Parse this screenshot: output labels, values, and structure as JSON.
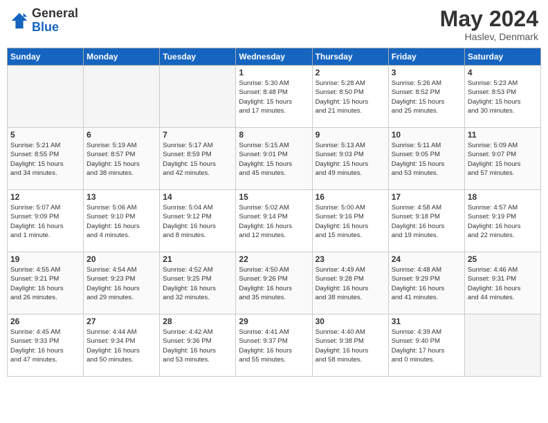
{
  "header": {
    "logo_general": "General",
    "logo_blue": "Blue",
    "month_year": "May 2024",
    "location": "Haslev, Denmark"
  },
  "days_of_week": [
    "Sunday",
    "Monday",
    "Tuesday",
    "Wednesday",
    "Thursday",
    "Friday",
    "Saturday"
  ],
  "weeks": [
    [
      {
        "day": "",
        "info": ""
      },
      {
        "day": "",
        "info": ""
      },
      {
        "day": "",
        "info": ""
      },
      {
        "day": "1",
        "info": "Sunrise: 5:30 AM\nSunset: 8:48 PM\nDaylight: 15 hours\nand 17 minutes."
      },
      {
        "day": "2",
        "info": "Sunrise: 5:28 AM\nSunset: 8:50 PM\nDaylight: 15 hours\nand 21 minutes."
      },
      {
        "day": "3",
        "info": "Sunrise: 5:26 AM\nSunset: 8:52 PM\nDaylight: 15 hours\nand 25 minutes."
      },
      {
        "day": "4",
        "info": "Sunrise: 5:23 AM\nSunset: 8:53 PM\nDaylight: 15 hours\nand 30 minutes."
      }
    ],
    [
      {
        "day": "5",
        "info": "Sunrise: 5:21 AM\nSunset: 8:55 PM\nDaylight: 15 hours\nand 34 minutes."
      },
      {
        "day": "6",
        "info": "Sunrise: 5:19 AM\nSunset: 8:57 PM\nDaylight: 15 hours\nand 38 minutes."
      },
      {
        "day": "7",
        "info": "Sunrise: 5:17 AM\nSunset: 8:59 PM\nDaylight: 15 hours\nand 42 minutes."
      },
      {
        "day": "8",
        "info": "Sunrise: 5:15 AM\nSunset: 9:01 PM\nDaylight: 15 hours\nand 45 minutes."
      },
      {
        "day": "9",
        "info": "Sunrise: 5:13 AM\nSunset: 9:03 PM\nDaylight: 15 hours\nand 49 minutes."
      },
      {
        "day": "10",
        "info": "Sunrise: 5:11 AM\nSunset: 9:05 PM\nDaylight: 15 hours\nand 53 minutes."
      },
      {
        "day": "11",
        "info": "Sunrise: 5:09 AM\nSunset: 9:07 PM\nDaylight: 15 hours\nand 57 minutes."
      }
    ],
    [
      {
        "day": "12",
        "info": "Sunrise: 5:07 AM\nSunset: 9:09 PM\nDaylight: 16 hours\nand 1 minute."
      },
      {
        "day": "13",
        "info": "Sunrise: 5:06 AM\nSunset: 9:10 PM\nDaylight: 16 hours\nand 4 minutes."
      },
      {
        "day": "14",
        "info": "Sunrise: 5:04 AM\nSunset: 9:12 PM\nDaylight: 16 hours\nand 8 minutes."
      },
      {
        "day": "15",
        "info": "Sunrise: 5:02 AM\nSunset: 9:14 PM\nDaylight: 16 hours\nand 12 minutes."
      },
      {
        "day": "16",
        "info": "Sunrise: 5:00 AM\nSunset: 9:16 PM\nDaylight: 16 hours\nand 15 minutes."
      },
      {
        "day": "17",
        "info": "Sunrise: 4:58 AM\nSunset: 9:18 PM\nDaylight: 16 hours\nand 19 minutes."
      },
      {
        "day": "18",
        "info": "Sunrise: 4:57 AM\nSunset: 9:19 PM\nDaylight: 16 hours\nand 22 minutes."
      }
    ],
    [
      {
        "day": "19",
        "info": "Sunrise: 4:55 AM\nSunset: 9:21 PM\nDaylight: 16 hours\nand 26 minutes."
      },
      {
        "day": "20",
        "info": "Sunrise: 4:54 AM\nSunset: 9:23 PM\nDaylight: 16 hours\nand 29 minutes."
      },
      {
        "day": "21",
        "info": "Sunrise: 4:52 AM\nSunset: 9:25 PM\nDaylight: 16 hours\nand 32 minutes."
      },
      {
        "day": "22",
        "info": "Sunrise: 4:50 AM\nSunset: 9:26 PM\nDaylight: 16 hours\nand 35 minutes."
      },
      {
        "day": "23",
        "info": "Sunrise: 4:49 AM\nSunset: 9:28 PM\nDaylight: 16 hours\nand 38 minutes."
      },
      {
        "day": "24",
        "info": "Sunrise: 4:48 AM\nSunset: 9:29 PM\nDaylight: 16 hours\nand 41 minutes."
      },
      {
        "day": "25",
        "info": "Sunrise: 4:46 AM\nSunset: 9:31 PM\nDaylight: 16 hours\nand 44 minutes."
      }
    ],
    [
      {
        "day": "26",
        "info": "Sunrise: 4:45 AM\nSunset: 9:33 PM\nDaylight: 16 hours\nand 47 minutes."
      },
      {
        "day": "27",
        "info": "Sunrise: 4:44 AM\nSunset: 9:34 PM\nDaylight: 16 hours\nand 50 minutes."
      },
      {
        "day": "28",
        "info": "Sunrise: 4:42 AM\nSunset: 9:36 PM\nDaylight: 16 hours\nand 53 minutes."
      },
      {
        "day": "29",
        "info": "Sunrise: 4:41 AM\nSunset: 9:37 PM\nDaylight: 16 hours\nand 55 minutes."
      },
      {
        "day": "30",
        "info": "Sunrise: 4:40 AM\nSunset: 9:38 PM\nDaylight: 16 hours\nand 58 minutes."
      },
      {
        "day": "31",
        "info": "Sunrise: 4:39 AM\nSunset: 9:40 PM\nDaylight: 17 hours\nand 0 minutes."
      },
      {
        "day": "",
        "info": ""
      }
    ]
  ]
}
